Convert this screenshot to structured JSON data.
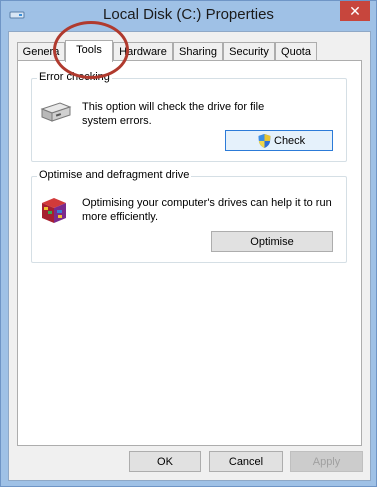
{
  "window": {
    "title": "Local Disk (C:) Properties",
    "close_label": "✕"
  },
  "tabs": [
    "Genera",
    "Tools",
    "Hardware",
    "Sharing",
    "Security",
    "Quota"
  ],
  "error_checking": {
    "label": "Error checking",
    "text_line1": "This option will check the drive for file",
    "text_line2": "system errors.",
    "button": "Check"
  },
  "optimise": {
    "label": "Optimise and defragment drive",
    "text_line1": "Optimising your computer's drives can help it to run",
    "text_line2": "more efficiently.",
    "button": "Optimise"
  },
  "footer": {
    "ok": "OK",
    "cancel": "Cancel",
    "apply": "Apply"
  },
  "colors": {
    "frame": "#9fc1e6",
    "close": "#c7463d",
    "annotation": "#b03a2e"
  }
}
